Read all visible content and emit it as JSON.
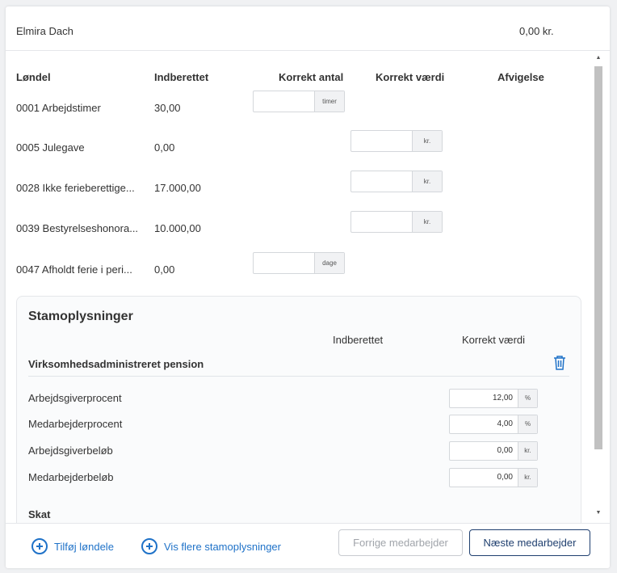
{
  "employee": {
    "name": "Elmira Dach",
    "amount": "0,00 kr."
  },
  "table": {
    "headers": {
      "lonndel": "Løndel",
      "indberettet": "Indberettet",
      "korrekt_antal": "Korrekt antal",
      "korrekt_vaerdi": "Korrekt værdi",
      "afvigelse": "Afvigelse"
    },
    "rows": [
      {
        "label": "0001 Arbejdstimer",
        "reported": "30,00",
        "unit": "timer",
        "column": "antal"
      },
      {
        "label": "0005 Julegave",
        "reported": "0,00",
        "unit": "kr.",
        "column": "vaerdi"
      },
      {
        "label": "0028 Ikke ferieberettige...",
        "reported": "17.000,00",
        "unit": "kr.",
        "column": "vaerdi"
      },
      {
        "label": "0039 Bestyrelseshonora...",
        "reported": "10.000,00",
        "unit": "kr.",
        "column": "vaerdi"
      },
      {
        "label": "0047 Afholdt ferie i peri...",
        "reported": "0,00",
        "unit": "dage",
        "column": "antal"
      }
    ]
  },
  "stamoplysninger": {
    "title": "Stamoplysninger",
    "col_indberettet": "Indberettet",
    "col_korrekt_vaerdi": "Korrekt værdi",
    "pension_title": "Virksomhedsadministreret pension",
    "fields": [
      {
        "label": "Arbejdsgiverprocent",
        "value": "12,00",
        "unit": "%"
      },
      {
        "label": "Medarbejderprocent",
        "value": "4,00",
        "unit": "%"
      },
      {
        "label": "Arbejdsgiverbeløb",
        "value": "0,00",
        "unit": "kr."
      },
      {
        "label": "Medarbejderbeløb",
        "value": "0,00",
        "unit": "kr."
      }
    ],
    "skat_title": "Skat"
  },
  "footer": {
    "add_lonndele": "Tilføj løndele",
    "show_more": "Vis flere stamoplysninger",
    "prev": "Forrige medarbejder",
    "next": "Næste medarbejder"
  },
  "colors": {
    "accent": "#1f72c8",
    "navy": "#1f3f6f"
  },
  "icons": {
    "add": "plus-circle-icon",
    "delete": "trash-icon",
    "scroll_up": "caret-up-icon",
    "scroll_down": "caret-down-icon"
  }
}
